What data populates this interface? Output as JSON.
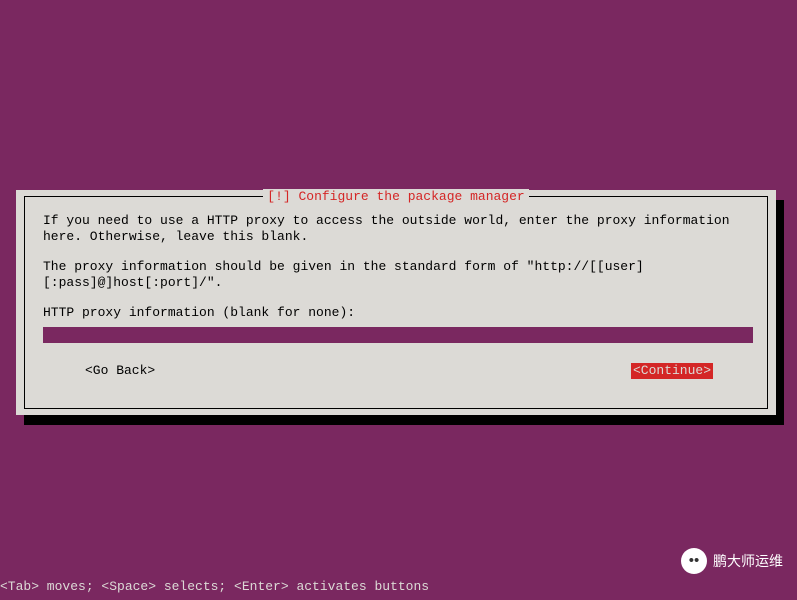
{
  "dialog": {
    "title": "[!] Configure the package manager",
    "para1": "If you need to use a HTTP proxy to access the outside world, enter the proxy information here. Otherwise, leave this blank.",
    "para2": "The proxy information should be given in the standard form of \"http://[[user][:pass]@]host[:port]/\".",
    "prompt": "HTTP proxy information (blank for none):",
    "input_value": "",
    "go_back": "<Go Back>",
    "continue": "<Continue>"
  },
  "footer": "<Tab> moves; <Space> selects; <Enter> activates buttons",
  "watermark": {
    "icon": "••",
    "text": "鹏大师运维"
  }
}
